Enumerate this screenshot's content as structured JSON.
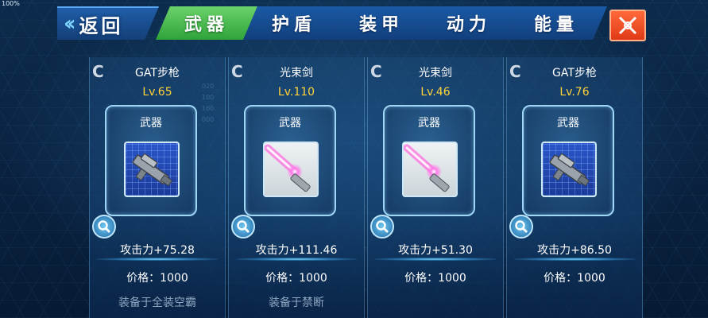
{
  "corner_label": "100%",
  "nav": {
    "back_label": "返回",
    "tabs": [
      {
        "label": "武器",
        "active": true
      },
      {
        "label": "护盾",
        "active": false
      },
      {
        "label": "装甲",
        "active": false
      },
      {
        "label": "动力",
        "active": false
      },
      {
        "label": "能量",
        "active": false
      }
    ]
  },
  "cards": [
    {
      "grade": "C",
      "name": "GAT步枪",
      "level": "Lv.65",
      "type": "武器",
      "icon": "rifle-icon",
      "attack": "攻击力+75.28",
      "price": "价格：1000",
      "equipped": "装备于全装空霸"
    },
    {
      "grade": "C",
      "name": "光束剑",
      "level": "Lv.110",
      "type": "武器",
      "icon": "beam-saber-icon",
      "attack": "攻击力+111.46",
      "price": "价格：1000",
      "equipped": "装备于禁断"
    },
    {
      "grade": "C",
      "name": "光束剑",
      "level": "Lv.46",
      "type": "武器",
      "icon": "beam-saber-icon",
      "attack": "攻击力+51.30",
      "price": "价格：1000",
      "equipped": ""
    },
    {
      "grade": "C",
      "name": "GAT步枪",
      "level": "Lv.76",
      "type": "武器",
      "icon": "rifle-icon",
      "attack": "攻击力+86.50",
      "price": "价格：1000",
      "equipped": ""
    }
  ],
  "scale_marks": [
    "020",
    "100",
    "160",
    "000",
    "020"
  ],
  "colors": {
    "active_tab": "#3fb546",
    "inactive_tab": "#1a5aa6",
    "level_text": "#ffd23a",
    "close_button": "#ef4a22"
  }
}
